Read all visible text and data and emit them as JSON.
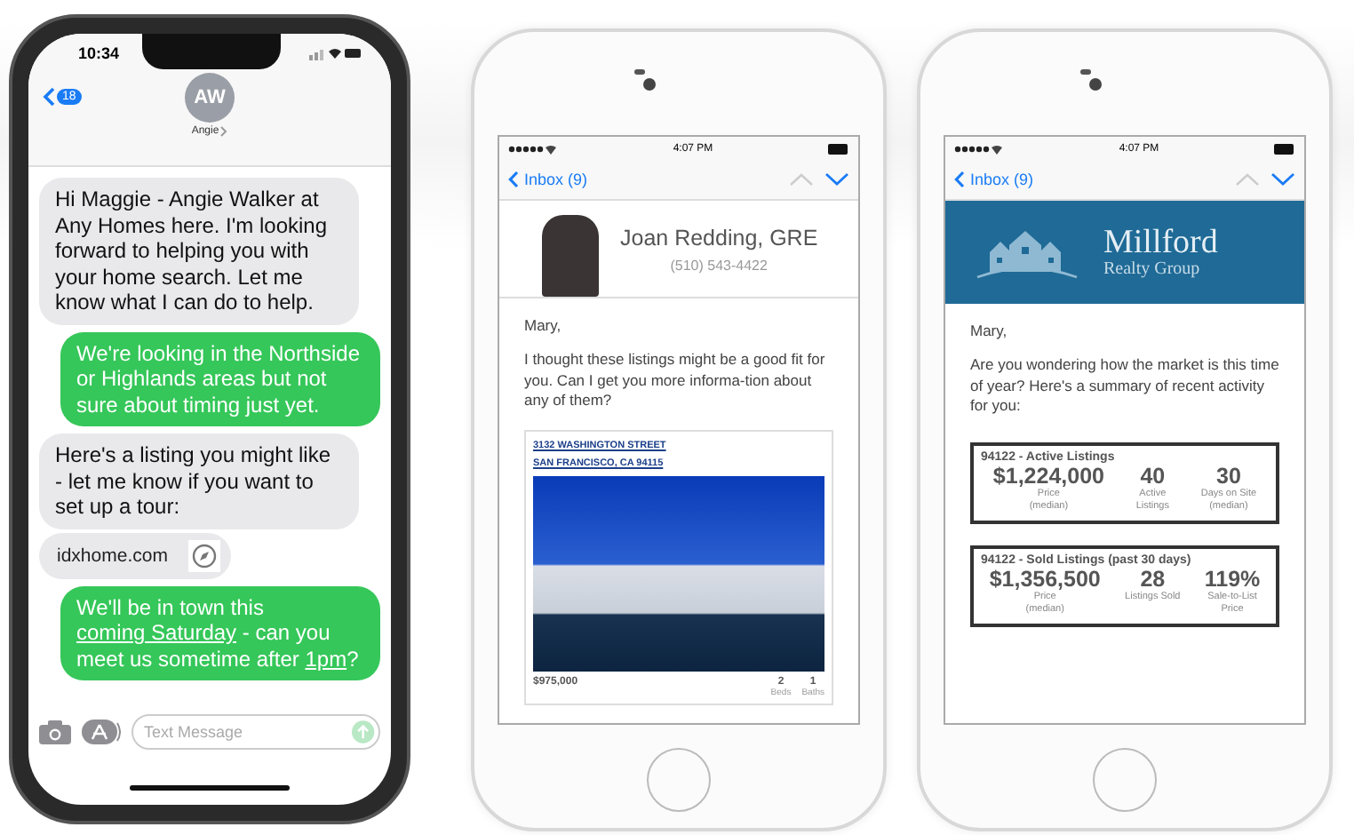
{
  "messages_phone": {
    "status": {
      "time": "10:34"
    },
    "header": {
      "back_badge": "18",
      "avatar_initials": "AW",
      "contact": "Angie"
    },
    "messages": [
      {
        "kind": "received",
        "parts": [
          {
            "text": "Hi Maggie - Angie Walker at Any Homes here. I'm looking forward to helping you with your home search. Let me know what I can do to help.",
            "link": false
          }
        ]
      },
      {
        "kind": "sent",
        "parts": [
          {
            "text": "We're looking in the Northside or Highlands areas but not sure about timing just yet.",
            "link": false
          }
        ]
      },
      {
        "kind": "received",
        "parts": [
          {
            "text": "Here's a listing you might like - let me know if you want to set up a tour:",
            "link": false
          }
        ]
      },
      {
        "kind": "link",
        "url": "idxhome.com"
      },
      {
        "kind": "sent",
        "parts": [
          {
            "text": "We'll be in town this ",
            "link": false
          },
          {
            "text": "coming Saturday",
            "link": true
          },
          {
            "text": " - can you meet us sometime after ",
            "link": false
          },
          {
            "text": "1pm",
            "link": true
          },
          {
            "text": "?",
            "link": false
          }
        ]
      }
    ],
    "input": {
      "placeholder": "Text Message"
    }
  },
  "agent_email_phone": {
    "status": {
      "time": "4:07 PM"
    },
    "nav": {
      "back": "Inbox (9)"
    },
    "agent": {
      "name": "Joan Redding, GRE",
      "phone": "(510) 543-4422"
    },
    "greeting": "Mary,",
    "body": "I thought these listings might be a good fit for you. Can I get you more informa-tion about any of them?",
    "listing": {
      "address_lines": [
        "3132 WASHINGTON STREET",
        "SAN FRANCISCO, CA 94115"
      ],
      "price": "$975,000",
      "stats": [
        {
          "value": "2",
          "label": "Beds"
        },
        {
          "value": "1",
          "label": "Baths"
        }
      ]
    }
  },
  "market_email_phone": {
    "status": {
      "time": "4:07 PM"
    },
    "nav": {
      "back": "Inbox (9)"
    },
    "logo": {
      "name": "Millford",
      "subtitle": "Realty Group"
    },
    "greeting": "Mary,",
    "body": "Are you wondering how the market is this time of year? Here's a summary of recent activity for you:",
    "cards": [
      {
        "title": "94122 - Active Listings",
        "stats": [
          {
            "value": "$1,224,000",
            "label": "Price\n(median)"
          },
          {
            "value": "40",
            "label": "Active\nListings"
          },
          {
            "value": "30",
            "label": "Days on Site\n(median)"
          }
        ]
      },
      {
        "title": "94122 - Sold Listings (past 30 days)",
        "stats": [
          {
            "value": "$1,356,500",
            "label": "Price\n(median)"
          },
          {
            "value": "28",
            "label": "Listings Sold"
          },
          {
            "value": "119%",
            "label": "Sale-to-List\nPrice"
          }
        ]
      }
    ]
  }
}
